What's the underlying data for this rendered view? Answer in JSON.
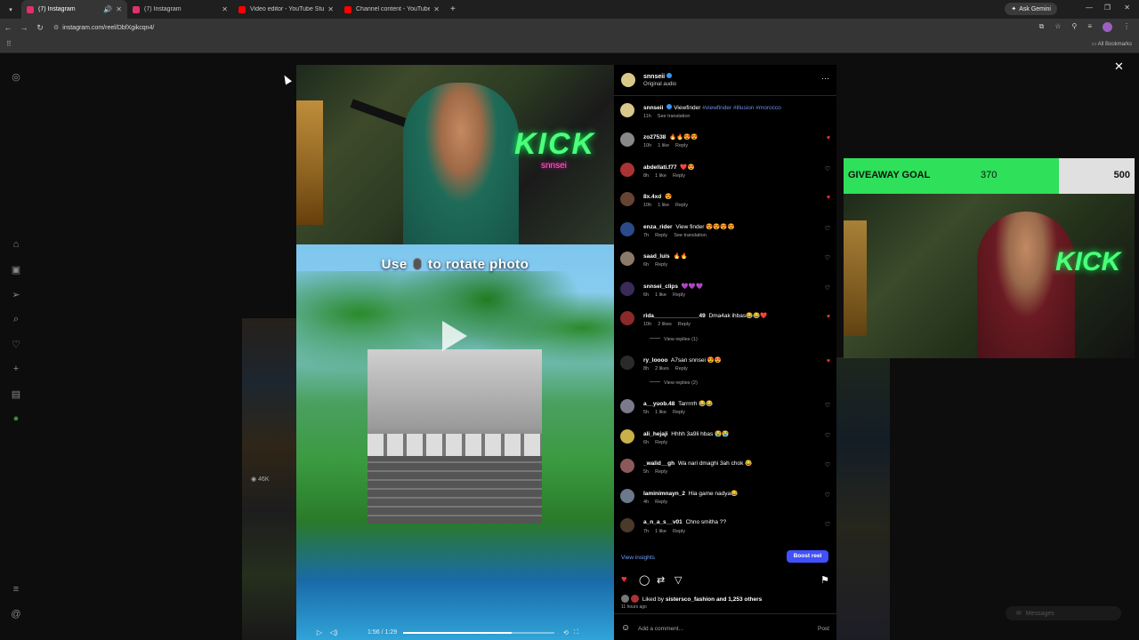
{
  "tabs": [
    {
      "title": "(7) Instagram",
      "favicon_color": "#e1306c",
      "active": true
    },
    {
      "title": "(7) Instagram",
      "favicon_color": "#e1306c",
      "active": false
    },
    {
      "title": "Video editor - YouTube Studio",
      "favicon_color": "#ff0000",
      "active": false
    },
    {
      "title": "Channel content - YouTube Stu...",
      "favicon_color": "#ff0000",
      "active": false
    }
  ],
  "ask_gemini": "Ask Gemini",
  "url": "instagram.com/reel/DbfXgikcqn4/",
  "all_bookmarks": "All Bookmarks",
  "reel": {
    "caption_before": "Use",
    "caption_after": "to rotate photo",
    "neon_text": "KICK",
    "time": "1:56 / 1:29",
    "progress": 0.72
  },
  "post": {
    "username": "snnseii",
    "audio": "Original audio",
    "description_text": "Viewfinder",
    "hashtags": "#viewfinder #illusion #morocco",
    "description_time": "11h",
    "see_translation": "See translation"
  },
  "comments": [
    {
      "user": "zo27538",
      "text": "🔥🔥😍😍",
      "time": "10h",
      "likes": "1 like",
      "reply": "Reply",
      "liked": true,
      "avatar": "#888"
    },
    {
      "user": "abdellati.f77",
      "text": "❤️😍",
      "time": "8h",
      "likes": "1 like",
      "reply": "Reply",
      "liked": false,
      "avatar": "#a33"
    },
    {
      "user": "8x.4xd",
      "text": "😍",
      "time": "10h",
      "likes": "1 like",
      "reply": "Reply",
      "liked": true,
      "avatar": "#643"
    },
    {
      "user": "enza_rider",
      "text": "View finder 😍😍😍😍",
      "time": "7h",
      "likes": "",
      "reply": "Reply",
      "extra": "See translation",
      "liked": false,
      "avatar": "#2b4a8a"
    },
    {
      "user": "saad_luis",
      "text": "🔥🔥",
      "time": "6h",
      "likes": "",
      "reply": "Reply",
      "liked": false,
      "avatar": "#8a7a6a"
    },
    {
      "user": "snnsei_clips",
      "text": "💜💜💜",
      "time": "6h",
      "likes": "1 like",
      "reply": "Reply",
      "liked": false,
      "avatar": "#3a2a5a"
    },
    {
      "user": "rida______________49",
      "text": "Dma4ak ihbas😂😂❤️",
      "time": "10h",
      "likes": "2 likes",
      "reply": "Reply",
      "liked": true,
      "avatar": "#8a2a2a",
      "view_replies": "View replies (1)"
    },
    {
      "user": "ry_loooo",
      "text": "A7san snnsei 😍😍",
      "time": "8h",
      "likes": "2 likes",
      "reply": "Reply",
      "liked": true,
      "avatar": "#2a2a2a",
      "view_replies": "View replies (2)"
    },
    {
      "user": "a__yuob.48",
      "text": "Tarrrrrh 😂😂",
      "time": "5h",
      "likes": "1 like",
      "reply": "Reply",
      "liked": false,
      "avatar": "#7a7a8a"
    },
    {
      "user": "ali_hejaji",
      "text": "Hhhh 3a9li hbas 😭😭",
      "time": "6h",
      "likes": "",
      "reply": "Reply",
      "liked": false,
      "avatar": "#c8b04a"
    },
    {
      "user": "_walid__gh",
      "text": "Wa nari dmaghi 3ah chok 😂",
      "time": "5h",
      "likes": "",
      "reply": "Reply",
      "liked": false,
      "avatar": "#8a5a5a"
    },
    {
      "user": "laminimnayn_2",
      "text": "Hia game nadya😂",
      "time": "4h",
      "likes": "",
      "reply": "Reply",
      "liked": false,
      "avatar": "#6a7a8a"
    },
    {
      "user": "a_n_a_s__v01",
      "text": "Chno smitha ??",
      "time": "7h",
      "likes": "1 like",
      "reply": "Reply",
      "liked": false,
      "avatar": "#4a3a2a"
    }
  ],
  "view_insights": "View insights",
  "boost_reel": "Boost reel",
  "liked_by_prefix": "Liked by",
  "liked_by_user": "sistersco_fashion",
  "liked_by_suffix": "and 1,253 others",
  "post_age": "11 hours ago",
  "add_comment_placeholder": "Add a comment...",
  "post_button": "Post",
  "bg_views": "46K",
  "giveaway": {
    "label": "GIVEAWAY GOAL",
    "current": "370",
    "target": "500",
    "progress": 0.74
  },
  "facecam_neon": "KICK",
  "messages_label": "Messages"
}
